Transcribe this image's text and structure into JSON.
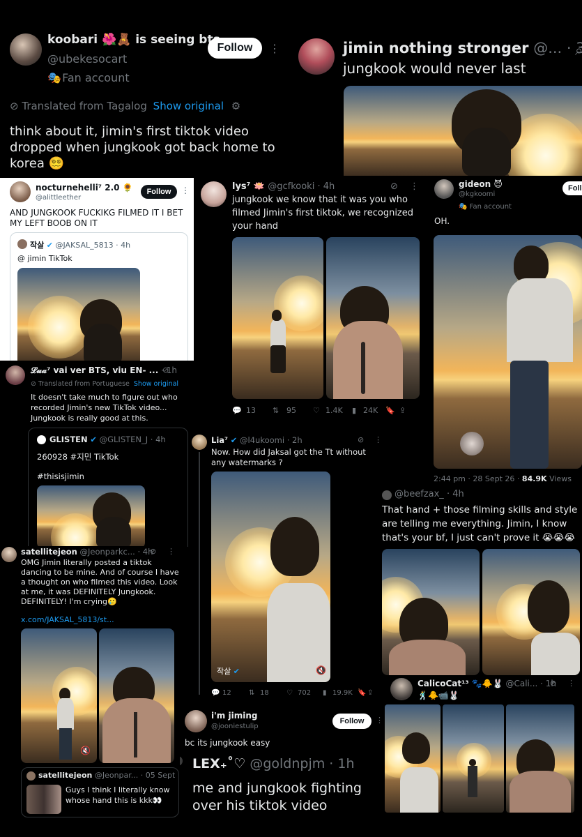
{
  "tweets": {
    "koobari": {
      "name": "koobari 🌺🧸 is seeing bts ...",
      "handle": "@ubekesocart",
      "badge": "Fan account",
      "follow": "Follow",
      "translated": "Translated from Tagalog",
      "show_original": "Show original",
      "text": "think about it, jimin's first tiktok video dropped when jungkook got back home to korea 😵‍💫"
    },
    "jimin_nothing": {
      "name": "jimin nothing stronger",
      "handle": "@...",
      "time": "· 3h",
      "text": "jungkook would never last"
    },
    "nocturne": {
      "name": "nocturnehelli⁷ 2.0 🌻",
      "handle": "@alittleether",
      "follow": "Follow",
      "text": "AND JUNGKOOK FUCKIKG FILMED IT I BET MY LEFT BOOB ON IT",
      "quote_name": "작살",
      "quote_handle": "@JAKSAL_5813 · 4h",
      "quote_text": "@ jimin TikTok"
    },
    "lys": {
      "name": "lys⁷ 🪷",
      "handle": "@gcfkooki · 4h",
      "text": "jungkook we know that it was you who filmed Jimin's first tiktok, we recognized your hand",
      "replies": "13",
      "retweets": "95",
      "likes": "1.4K",
      "views": "24K"
    },
    "gideon": {
      "name": "gideon 😈",
      "handle": "@kgkoomi",
      "badge": "Fan account",
      "follow": "Foll",
      "text": "OH.",
      "meta": "2:44 pm · 28 Sept 26 · ",
      "views_count": "84.9K",
      "views_label": " Views"
    },
    "lua": {
      "name": "𝓛𝓾𝓪⁷ vai ver BTS, viu EN- ...",
      "time": "· 1h",
      "translated": "Translated from Portuguese",
      "show_original": "Show original",
      "text": "It doesn't take much to figure out who recorded Jimin's new TikTok video... Jungkook is really good at this."
    },
    "glisten": {
      "name": "GLISTEN",
      "handle": "@GLISTEN_J · 4h",
      "text": "260928 #지민 TikTok",
      "hashtag": "#thisisjimin"
    },
    "lia": {
      "name": "Lia⁷",
      "handle": "@l4ukoomi · 2h",
      "text": "Now. How did Jaksal got the Tt without any watermarks ?",
      "watermark": "작살",
      "replies": "12",
      "retweets": "18",
      "likes": "702",
      "views": "19.9K"
    },
    "beefzax": {
      "handle": "@beefzax_ · 4h",
      "text": "That hand + those filming skills and style are telling me everything. Jimin, I know that's your bf, I just can't prove it 😭😭😭"
    },
    "satellite": {
      "name": "satellitejeon",
      "handle": "@Jeonparkc... · 4h",
      "text": "OMG Jimin literally posted a tiktok dancing to be mine. And of course I have a thought on who filmed this video. Look at me, it was DEFINITELY Jungkook. DEFINITELY! I'm crying🥲",
      "link": "x.com/JAKSAL_5813/st..."
    },
    "satellite2": {
      "name": "satellitejeon",
      "handle": "@Jeonpar... · 05 Sept",
      "text": "Guys I think I literally know whose hand this is kkk👀"
    },
    "iming": {
      "name": "i'm jiming",
      "handle": "@jooniestulip",
      "follow": "Follow",
      "text": "bc its jungkook easy"
    },
    "calico": {
      "name": "CalicoCat¹³ 🐾🐥🐰",
      "handle": "@Cali... · 1h",
      "emojis": "🕺🐥📹🐰"
    },
    "lex": {
      "name": "LEX₊˚♡",
      "handle": "@goldnpjm · 1h",
      "text": "me and jungkook fighting over his tiktok video"
    }
  },
  "icons": [
    "more-icon",
    "gear-icon",
    "translate-icon",
    "verified-icon",
    "reply-icon",
    "retweet-icon",
    "like-icon",
    "views-icon",
    "bookmark-icon",
    "share-icon",
    "mute-icon",
    "search-icon",
    "mask-icon"
  ],
  "colors": {
    "accent": "#1d9bf0",
    "muted": "#71767b",
    "background": "#000000"
  }
}
